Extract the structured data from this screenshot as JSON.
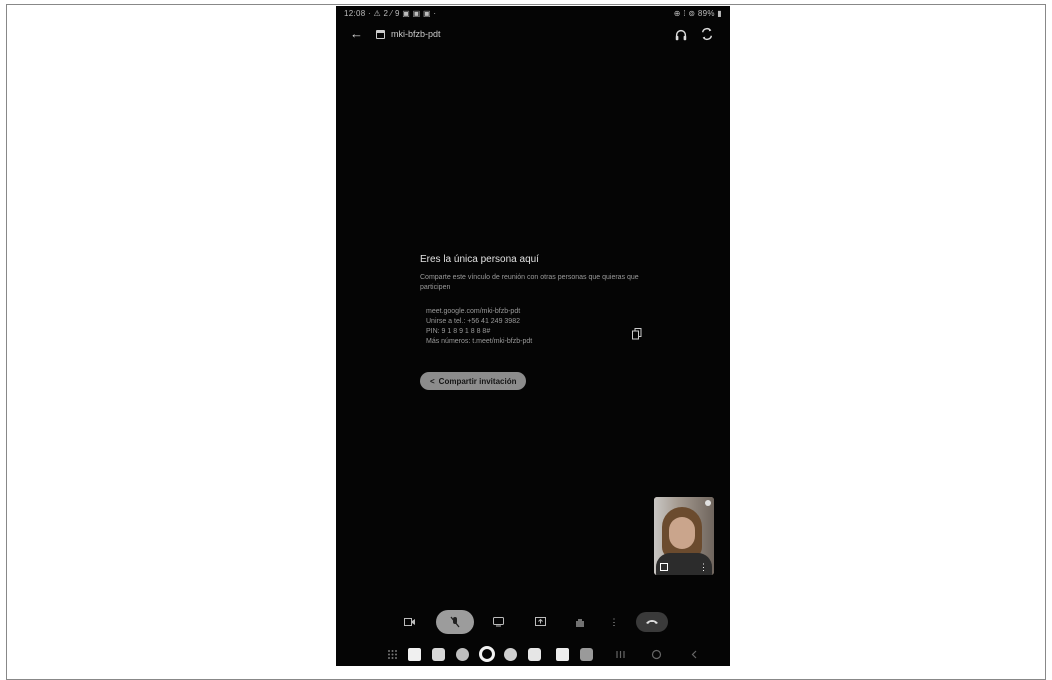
{
  "status_bar": {
    "left": "12:08 · ⚠ 2 ⁄ 9 ▣ ▣ ▣ ·",
    "right": "⊕ ⁞ ⊚ 89% ▮"
  },
  "header": {
    "meeting_code": "mki-bfzb-pdt"
  },
  "lobby": {
    "title": "Eres la única persona aquí",
    "subtitle": "Comparte este vínculo de reunión con otras personas que quieras que participen",
    "details": [
      "meet.google.com/mki-bfzb-pdt",
      "Unirse a tel.: +56 41 249 3982",
      "PIN: 9 1 8 9 1 8 8 8#",
      "Más números: t.meet/mki-bfzb-pdt"
    ],
    "share_label": "Compartir invitación"
  },
  "colors": {
    "background": "#050505",
    "share_button": "#8c8c8c",
    "mic_button": "#9c9c9c"
  },
  "icons": {
    "controls": [
      "camera-icon",
      "mic-off-icon",
      "captions-icon",
      "present-icon",
      "raise-hand-icon",
      "more-icon",
      "end-call-icon"
    ],
    "nav": [
      "apps-icon",
      "app-icon",
      "files-icon",
      "app-icon",
      "assistant-icon",
      "app-icon",
      "app-icon",
      "app-icon",
      "app-icon",
      "recents-icon",
      "home-icon",
      "back-icon"
    ]
  }
}
